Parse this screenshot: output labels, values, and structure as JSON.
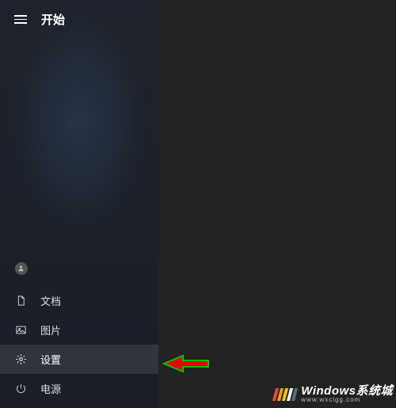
{
  "header": {
    "title": "开始"
  },
  "sidebar": {
    "items": [
      {
        "label": "文档",
        "icon": "document-icon"
      },
      {
        "label": "图片",
        "icon": "picture-icon"
      },
      {
        "label": "设置",
        "icon": "gear-icon"
      },
      {
        "label": "电源",
        "icon": "power-icon"
      }
    ]
  },
  "watermark": {
    "brand": "Windows系统城",
    "url": "www.wxclgg.com"
  }
}
